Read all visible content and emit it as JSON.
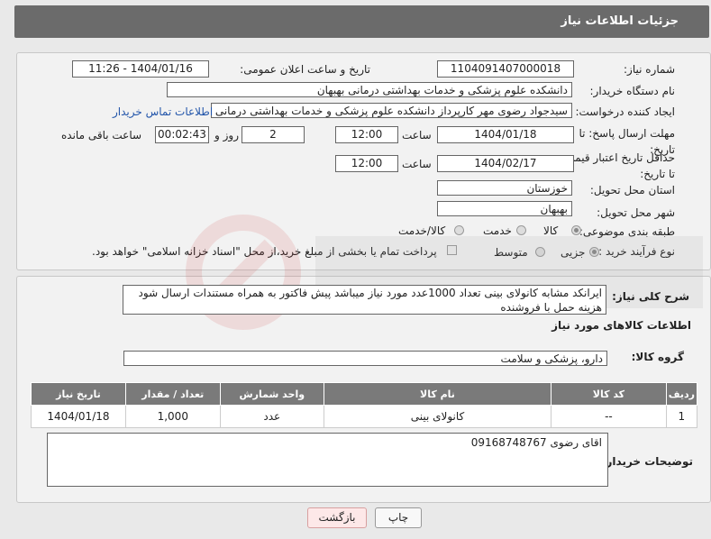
{
  "header": {
    "title": "جزئیات اطلاعات نیاز"
  },
  "fields": {
    "need_number_label": "شماره نیاز:",
    "need_number": "1104091407000018",
    "announce_label": "تاریخ و ساعت اعلان عمومی:",
    "announce_value": "1404/01/16 - 11:26",
    "buyer_label": "نام دستگاه خریدار:",
    "buyer_value": "دانشکده علوم پزشکی و خدمات بهداشتی  درمانی بهبهان",
    "creator_label": "ایجاد کننده درخواست:",
    "creator_value": "سیدجواد رضوی مهر کارپرداز دانشکده علوم پزشکی و خدمات بهداشتی  درمانی بهبهان",
    "contact_link": "اطلاعات تماس خریدار",
    "reply_deadline_label": "مهلت ارسال پاسخ: تا تاریخ:",
    "reply_date": "1404/01/18",
    "time_label": "ساعت",
    "reply_time": "12:00",
    "days": "2",
    "days_label": "روز و",
    "remaining": "00:02:43",
    "remaining_label": "ساعت باقی مانده",
    "price_deadline_label": "حداقل تاریخ اعتبار قیمت: تا تاریخ:",
    "price_date": "1404/02/17",
    "price_time": "12:00",
    "province_label": "استان محل تحویل:",
    "province": "خوزستان",
    "city_label": "شهر محل تحویل:",
    "city": "بهبهان",
    "category_label": "طبقه بندی موضوعی:",
    "category_options": [
      "کالا",
      "خدمت",
      "کالا/خدمت"
    ],
    "process_label": "نوع فرآیند خرید :",
    "process_options": [
      "جزیی",
      "متوسط"
    ],
    "payment_note": "پرداخت تمام یا بخشی از مبلغ خرید،از محل \"اسناد خزانه اسلامی\" خواهد بود."
  },
  "description": {
    "label": "شرح کلی نیاز:",
    "text": "ایرانکد مشابه کانولای بینی تعداد 1000عدد مورد نیاز میباشد پیش فاکتور به همراه مستندات ارسال شود هزینه حمل با فروشنده"
  },
  "goods": {
    "section_title": "اطلاعات کالاهای مورد نیاز",
    "group_label": "گروه کالا:",
    "group_value": "دارو، پزشکی و سلامت",
    "columns": [
      "ردیف",
      "کد کالا",
      "نام کالا",
      "واحد شمارش",
      "تعداد / مقدار",
      "تاریخ نیاز"
    ],
    "rows": [
      [
        "1",
        "--",
        "کانولای بینی",
        "عدد",
        "1,000",
        "1404/01/18"
      ]
    ]
  },
  "buyer_notes": {
    "label": "توضیحات خریدار:",
    "text": "اقای رضوی 09168748767"
  },
  "buttons": {
    "print": "چاپ",
    "back": "بازگشت"
  }
}
